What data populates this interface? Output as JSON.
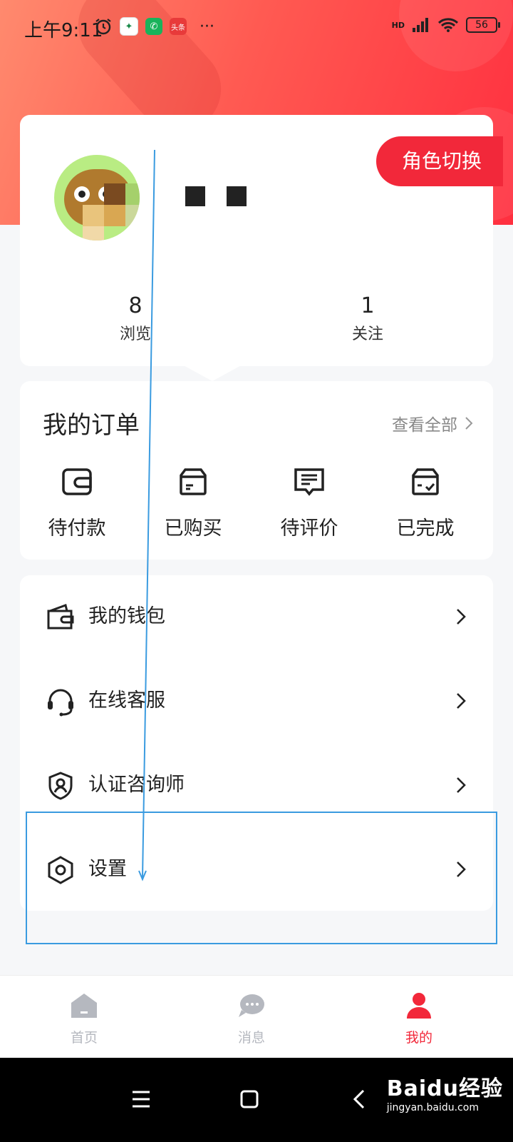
{
  "status_bar": {
    "time": "上午9:11",
    "extra": "···",
    "app_icons": [
      "alarm-icon",
      "video-app-icon",
      "phone-app-icon",
      "toutiao-app-icon"
    ],
    "toutiao_label": "头条",
    "battery": "56",
    "network": "HD"
  },
  "profile": {
    "role_switch_label": "角色切换",
    "stats": [
      {
        "value": "8",
        "label": "浏览"
      },
      {
        "value": "1",
        "label": "关注"
      }
    ]
  },
  "orders": {
    "title": "我的订单",
    "view_all": "查看全部",
    "items": [
      {
        "label": "待付款",
        "icon": "wallet-icon"
      },
      {
        "label": "已购买",
        "icon": "box-icon"
      },
      {
        "label": "待评价",
        "icon": "comment-icon"
      },
      {
        "label": "已完成",
        "icon": "done-box-icon"
      }
    ]
  },
  "menu": {
    "items": [
      {
        "label": "我的钱包",
        "icon": "wallet-icon"
      },
      {
        "label": "在线客服",
        "icon": "headset-icon"
      },
      {
        "label": "认证咨询师",
        "icon": "shield-user-icon"
      },
      {
        "label": "设置",
        "icon": "hexagon-settings-icon"
      }
    ]
  },
  "tabbar": {
    "tabs": [
      {
        "label": "首页",
        "icon": "home-icon",
        "active": false
      },
      {
        "label": "消息",
        "icon": "message-icon",
        "active": false
      },
      {
        "label": "我的",
        "icon": "user-icon",
        "active": true
      }
    ]
  },
  "watermark": {
    "main": "Baidu经验",
    "sub": "jingyan.baidu.com"
  },
  "colors": {
    "accent": "#f2283a",
    "inactive_tab": "#b5b8bf",
    "annotation": "#3a9be0"
  }
}
